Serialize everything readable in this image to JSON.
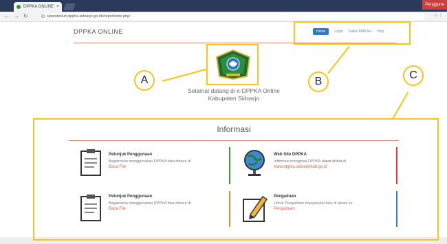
{
  "browser": {
    "tab_title": "DPPKA ONLINE",
    "url": "sipandeklub.dppka.sidoarjo.go.id/clepsihome.php/",
    "window_controls": "Pengguna"
  },
  "header": {
    "brand": "DPPKA ONLINE",
    "nav": [
      "Home",
      "Login",
      "Daftar APBDes",
      "Help"
    ]
  },
  "welcome": {
    "line1": "Selamat datang di e-DPPKA Online",
    "line2": "Kabupaten Sidoarjo"
  },
  "info": {
    "title": "Informasi",
    "cards": [
      {
        "icon": "clipboard-icon",
        "title": "Petunjuk Penggunaan",
        "desc": "Bagaimana menggunakan DPPKA bisa dibaca di",
        "link": "Baca File",
        "accent": "#3a9a3a"
      },
      {
        "icon": "globe-icon",
        "title": "Web Site DPPKA",
        "desc": "Informasi mengenai DPPKA dapat dilihat di",
        "link": "www.dppka.sidoarjokab.go.id",
        "accent": "#e03a3a"
      },
      {
        "icon": "clipboard-icon",
        "title": "Petunjuk Penggunaan",
        "desc": "Bagaimana menggunakan DPPKA bisa dibaca di",
        "link": "Baca File",
        "accent": "#e88a30"
      },
      {
        "icon": "pencil-icon",
        "title": "Pengaduan",
        "desc": "Untuk Pengaduan masyarakat bisa di akses ke",
        "link": "Pengaduan",
        "accent": "#3a7ac8"
      }
    ]
  },
  "annotations": {
    "a": "A",
    "b": "B",
    "c": "C"
  },
  "colors": {
    "annotation": "#f5c518",
    "accent_line": "#e08a7a",
    "nav_active": "#2f77c8"
  }
}
